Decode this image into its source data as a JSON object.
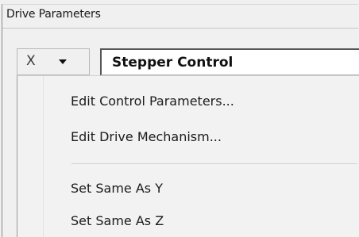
{
  "group": {
    "title": "Drive Parameters"
  },
  "axis": {
    "selected": "X",
    "arrow_icon": "chevron-down-icon"
  },
  "control": {
    "value": "Stepper Control"
  },
  "menu": {
    "items": [
      {
        "label": "Edit Control Parameters..."
      },
      {
        "label": "Edit Drive Mechanism..."
      },
      {
        "label": "Set Same As Y"
      },
      {
        "label": "Set Same As Z"
      }
    ]
  }
}
